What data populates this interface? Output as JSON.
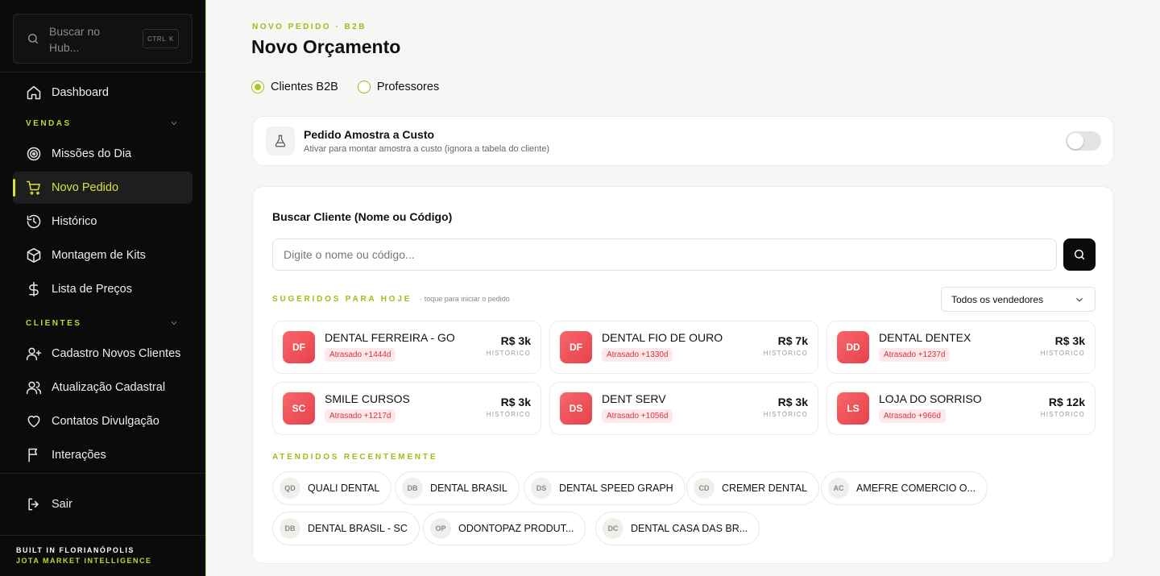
{
  "sidebar": {
    "search_placeholder": "Buscar no Hub...",
    "shortcut": [
      "CTRL",
      "K"
    ],
    "items": {
      "dashboard": "Dashboard",
      "missoes": "Missões do Dia",
      "novo_pedido": "Novo Pedido",
      "historico": "Histórico",
      "kits": "Montagem de Kits",
      "precos": "Lista de Preços",
      "cadastro": "Cadastro Novos Clientes",
      "atualizacao": "Atualização Cadastral",
      "contatos": "Contatos Divulgação",
      "interacoes": "Interações",
      "sair": "Sair"
    },
    "sections": {
      "vendas": "VENDAS",
      "clientes": "CLIENTES"
    },
    "footer": {
      "line1": "BUILT IN FLORIANÓPOLIS",
      "line2": "JOTA MARKET INTELLIGENCE"
    },
    "active_item": "novo_pedido"
  },
  "header": {
    "eyebrow": "NOVO PEDIDO · B2B",
    "title": "Novo Orçamento"
  },
  "radio": {
    "options": [
      "Clientes B2B",
      "Professores"
    ],
    "selected": "Clientes B2B"
  },
  "amostra": {
    "title": "Pedido Amostra a Custo",
    "subtitle": "Ativar para montar amostra a custo (ignora a tabela do cliente)",
    "enabled": false
  },
  "search": {
    "label": "Buscar Cliente (Nome ou Código)",
    "placeholder": "Digite o nome ou código...",
    "value": ""
  },
  "suggested": {
    "label": "SUGERIDOS PARA HOJE",
    "hint": "· toque para iniciar o pedido",
    "vendor_filter": "Todos os vendedores",
    "history_label": "HISTÓRICO",
    "clients": [
      {
        "initials": "DF",
        "name": "DENTAL FERREIRA - GO",
        "status": "Atrasado +1444d",
        "value": "R$ 3k"
      },
      {
        "initials": "DF",
        "name": "DENTAL FIO DE OURO",
        "status": "Atrasado +1330d",
        "value": "R$ 7k"
      },
      {
        "initials": "DD",
        "name": "DENTAL DENTEX",
        "status": "Atrasado +1237d",
        "value": "R$ 3k"
      },
      {
        "initials": "SC",
        "name": "SMILE CURSOS",
        "status": "Atrasado +1217d",
        "value": "R$ 3k"
      },
      {
        "initials": "DS",
        "name": "DENT SERV",
        "status": "Atrasado +1056d",
        "value": "R$ 3k"
      },
      {
        "initials": "LS",
        "name": "LOJA DO SORRISO",
        "status": "Atrasado +966d",
        "value": "R$ 12k"
      }
    ]
  },
  "recent": {
    "label": "ATENDIDOS RECENTEMENTE",
    "clients": [
      {
        "initials": "QD",
        "name": "QUALI DENTAL"
      },
      {
        "initials": "DB",
        "name": "DENTAL BRASIL"
      },
      {
        "initials": "DS",
        "name": "DENTAL SPEED GRAPH"
      },
      {
        "initials": "CD",
        "name": "CREMER DENTAL"
      },
      {
        "initials": "AC",
        "name": "AMEFRE COMERCIO O..."
      },
      {
        "initials": "DB",
        "name": "DENTAL BRASIL - SC"
      },
      {
        "initials": "OP",
        "name": "ODONTOPAZ PRODUT..."
      },
      {
        "initials": "DC",
        "name": "DENTAL CASA DAS BR..."
      }
    ]
  },
  "colors": {
    "accent": "#c6d62a",
    "sidebar_bg": "#0b0b0b",
    "avatar": "#ef5358",
    "overdue_text": "#d9343b"
  }
}
